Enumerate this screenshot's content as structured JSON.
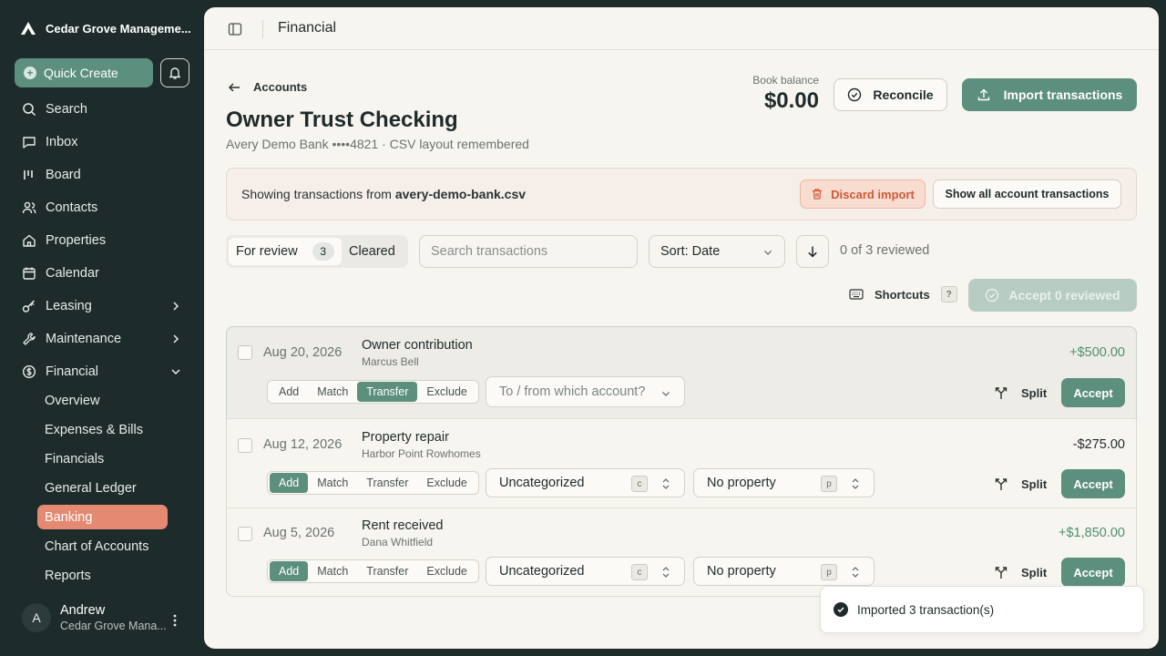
{
  "sidebar": {
    "org_name": "Cedar Grove Manageme...",
    "quick_create": "Quick Create",
    "nav": [
      {
        "label": "Search",
        "icon": "search-icon"
      },
      {
        "label": "Inbox",
        "icon": "inbox-icon"
      },
      {
        "label": "Board",
        "icon": "board-icon"
      },
      {
        "label": "Contacts",
        "icon": "contacts-icon"
      },
      {
        "label": "Properties",
        "icon": "home-icon"
      },
      {
        "label": "Calendar",
        "icon": "calendar-icon"
      },
      {
        "label": "Leasing",
        "icon": "key-icon"
      },
      {
        "label": "Maintenance",
        "icon": "wrench-icon"
      },
      {
        "label": "Financial",
        "icon": "dollar-icon"
      }
    ],
    "financial_sub": [
      "Overview",
      "Expenses & Bills",
      "Financials",
      "General Ledger",
      "Banking",
      "Chart of Accounts",
      "Reports"
    ],
    "active_sub": "Banking",
    "user": {
      "initial": "A",
      "name": "Andrew",
      "org": "Cedar Grove Mana..."
    }
  },
  "topbar": {
    "title": "Financial"
  },
  "account": {
    "back_label": "Accounts",
    "title": "Owner Trust Checking",
    "subtitle": "Avery Demo Bank ••••4821 · CSV layout remembered",
    "book_balance_label": "Book balance",
    "book_balance": "$0.00",
    "reconcile_label": "Reconcile",
    "import_label": "Import transactions"
  },
  "banner": {
    "prefix": "Showing transactions from ",
    "file": "avery-demo-bank.csv",
    "discard_label": "Discard import",
    "show_all_label": "Show all account transactions"
  },
  "filters": {
    "tab_review": "For review",
    "review_count": "3",
    "tab_cleared": "Cleared",
    "search_placeholder": "Search transactions",
    "sort_label": "Sort: Date",
    "reviewed_text": "0 of 3 reviewed",
    "shortcuts_label": "Shortcuts",
    "shortcuts_key": "?",
    "accept_all_label": "Accept 0 reviewed"
  },
  "actions": [
    "Add",
    "Match",
    "Transfer",
    "Exclude"
  ],
  "split_label": "Split",
  "accept_label": "Accept",
  "transactions": [
    {
      "date": "Aug 20, 2026",
      "description": "Owner contribution",
      "payee": "Marcus Bell",
      "amount": "+$500.00",
      "mode": "Transfer",
      "account_placeholder": "To / from which account?"
    },
    {
      "date": "Aug 12, 2026",
      "description": "Property repair",
      "payee": "Harbor Point Rowhomes",
      "amount": "-$275.00",
      "mode": "Add",
      "category": "Uncategorized",
      "category_key": "c",
      "property": "No property",
      "property_key": "p"
    },
    {
      "date": "Aug 5, 2026",
      "description": "Rent received",
      "payee": "Dana Whitfield",
      "amount": "+$1,850.00",
      "mode": "Add",
      "category": "Uncategorized",
      "category_key": "c",
      "property": "No property",
      "property_key": "p"
    }
  ],
  "toast": {
    "message": "Imported 3 transaction(s)"
  },
  "colors": {
    "accent": "#5d8f7e",
    "sidebar": "#1e2b2b",
    "active_nav": "#e48a73",
    "positive": "#4f8f6d",
    "danger": "#d0583b"
  }
}
